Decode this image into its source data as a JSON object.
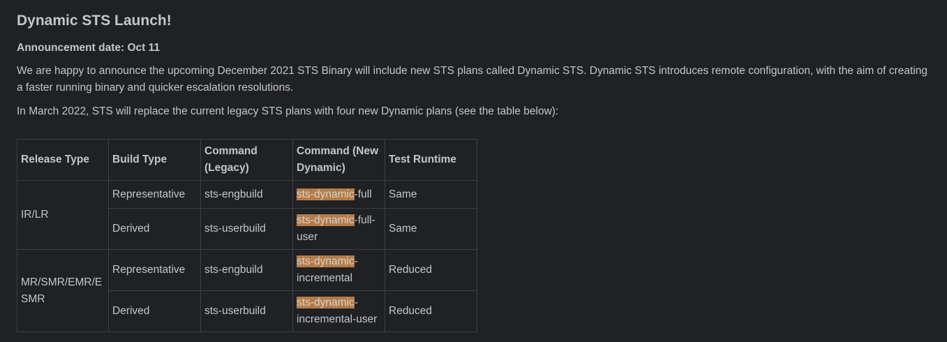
{
  "title": "Dynamic STS Launch!",
  "announcement_date": "Announcement date: Oct 11",
  "paragraphs": {
    "intro": "We are happy to announce the upcoming December 2021 STS Binary will include new STS plans called Dynamic STS. Dynamic STS introduces remote configuration, with the aim of creating a faster running binary and quicker escalation resolutions.",
    "march": "In March 2022, STS will replace the current legacy STS plans with four new Dynamic plans (see the table below):"
  },
  "table": {
    "headers": [
      "Release Type",
      "Build Type",
      "Command (Legacy)",
      "Command (New Dynamic)",
      "Test Runtime"
    ],
    "groups": [
      {
        "release_type": "IR/LR"
      },
      {
        "release_type": "MR/SMR/EMR/ESMR"
      }
    ],
    "rows": [
      {
        "build_type": "Representative",
        "legacy": "sts-engbuild",
        "dyn_highlight": "sts-dynamic",
        "dyn_rest": "-full",
        "runtime": "Same"
      },
      {
        "build_type": "Derived",
        "legacy": "sts-userbuild",
        "dyn_highlight": "sts-dynamic",
        "dyn_rest": "-full-user",
        "runtime": "Same"
      },
      {
        "build_type": "Representative",
        "legacy": "sts-engbuild",
        "dyn_highlight": "sts-dynamic",
        "dyn_rest": "-incremental",
        "runtime": "Reduced"
      },
      {
        "build_type": "Derived",
        "legacy": "sts-userbuild",
        "dyn_highlight": "sts-dynamic",
        "dyn_rest": "-incremental-user",
        "runtime": "Reduced"
      }
    ]
  },
  "colors": {
    "background": "#202124",
    "text": "#c4c6ca",
    "highlight": "#b57c49",
    "border": "#3f4043"
  }
}
